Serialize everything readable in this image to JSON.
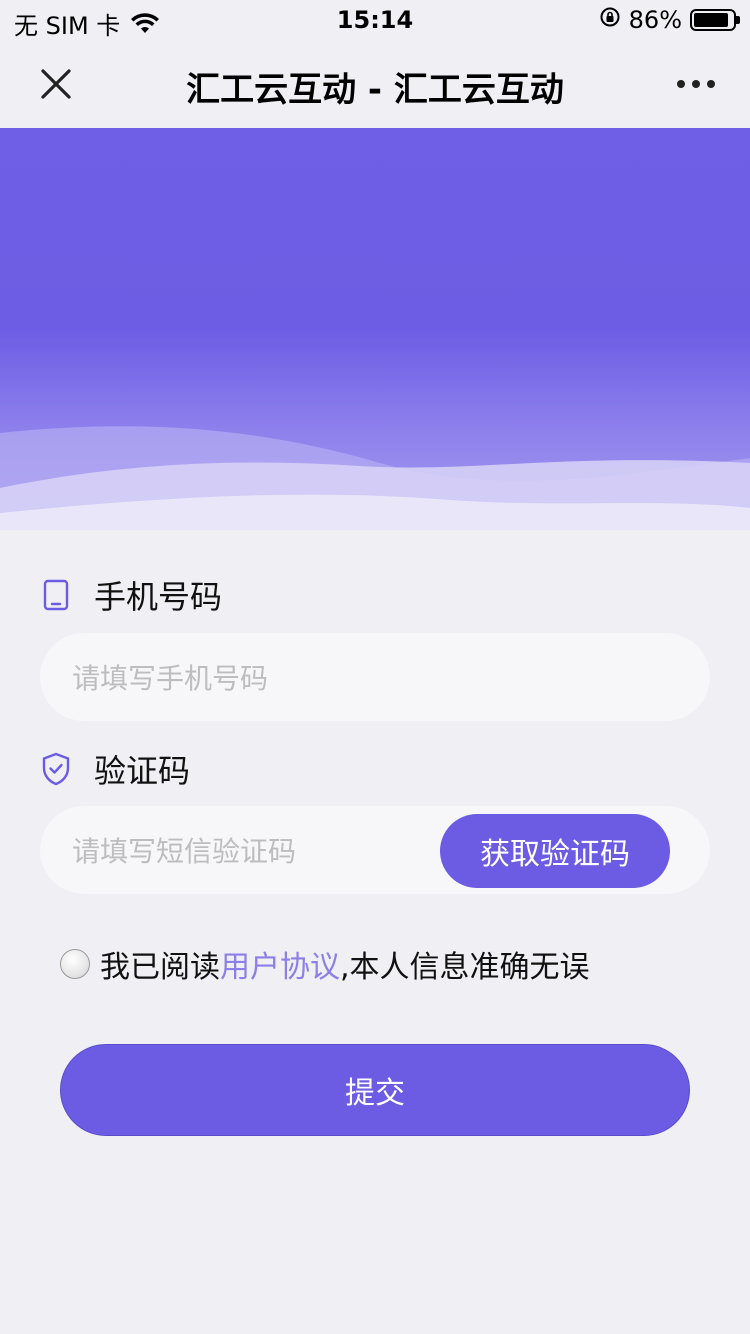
{
  "status_bar": {
    "carrier": "无 SIM 卡",
    "time": "15:14",
    "battery": "86%"
  },
  "nav": {
    "title": "汇工云互动 - 汇工云互动"
  },
  "form": {
    "phone_label": "手机号码",
    "phone_placeholder": "请填写手机号码",
    "code_label": "验证码",
    "code_placeholder": "请填写短信验证码",
    "get_code_label": "获取验证码"
  },
  "agreement": {
    "prefix": "我已阅读",
    "link": "用户协议",
    "suffix": ",本人信息准确无误"
  },
  "submit_label": "提交",
  "colors": {
    "accent": "#6c5ce4",
    "link": "#8c7fe8",
    "background": "#efeff4"
  }
}
